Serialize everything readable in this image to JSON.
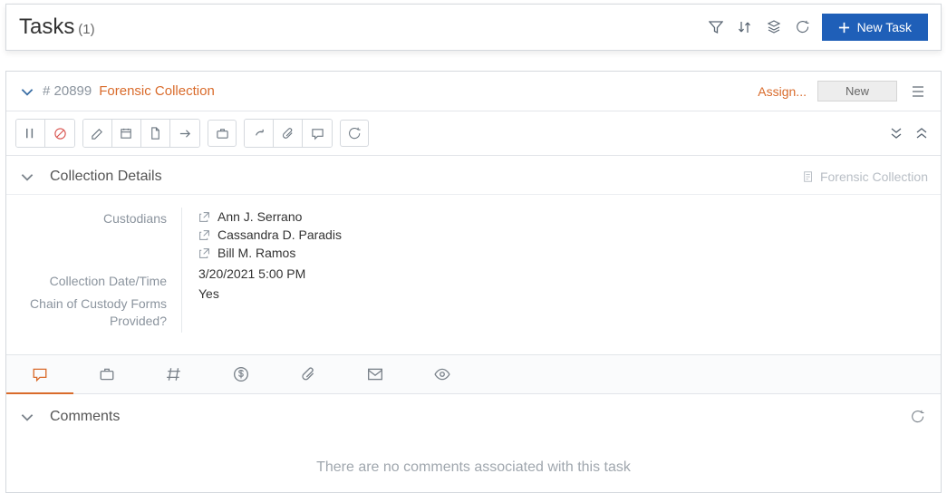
{
  "header": {
    "title": "Tasks",
    "count": "(1)",
    "new_task_label": "New Task"
  },
  "task": {
    "id": "# 20899",
    "name": "Forensic Collection",
    "assign_label": "Assign...",
    "status": "New"
  },
  "section": {
    "details_title": "Collection Details",
    "form_label": "Forensic Collection",
    "labels": {
      "custodians": "Custodians",
      "datetime": "Collection Date/Time",
      "chain": "Chain of Custody Forms Provided?"
    },
    "custodians": [
      "Ann J. Serrano",
      "Cassandra D. Paradis",
      "Bill M. Ramos"
    ],
    "datetime_value": "3/20/2021 5:00 PM",
    "chain_value": "Yes"
  },
  "comments": {
    "title": "Comments",
    "empty": "There are no comments associated with this task"
  }
}
